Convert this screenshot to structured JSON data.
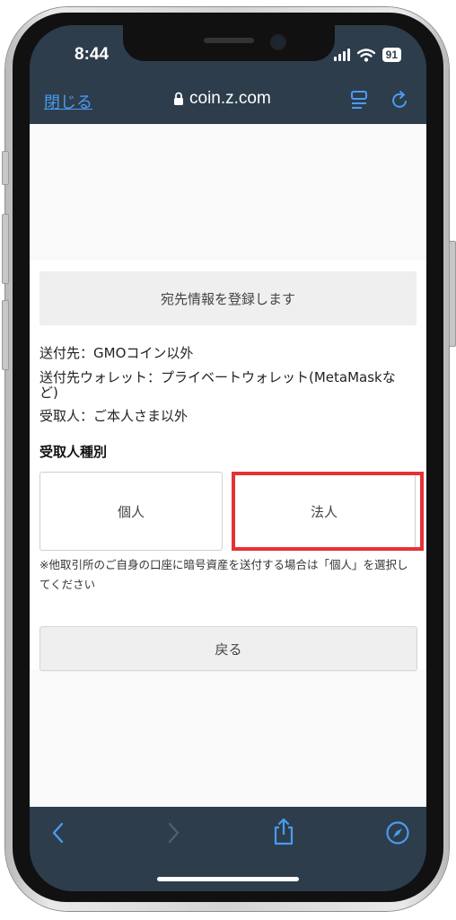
{
  "status": {
    "time": "8:44",
    "battery": "91"
  },
  "browser": {
    "close_label": "閉じる",
    "url": "coin.z.com"
  },
  "page": {
    "heading": "宛先情報を登録します",
    "info": [
      "送付先：GMOコイン以外",
      "送付先ウォレット：プライベートウォレット(MetaMaskなど)",
      "受取人：ご本人さま以外"
    ],
    "recipient_type_title": "受取人種別",
    "option_individual": "個人",
    "option_corporate": "法人",
    "note": "※他取引所のご自身の口座に暗号資産を送付する場合は「個人」を選択してください",
    "back_label": "戻る"
  },
  "colors": {
    "chrome": "#2d3d4c",
    "link": "#4a9bf0",
    "highlight": "#e53237"
  },
  "icons": [
    "lock-icon",
    "reader-icon",
    "reload-icon",
    "back-icon",
    "forward-icon",
    "share-icon",
    "compass-icon"
  ]
}
